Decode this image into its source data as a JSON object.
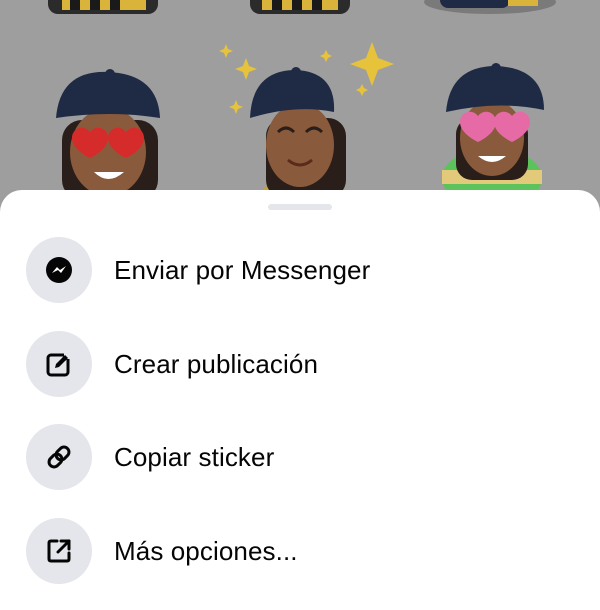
{
  "background": {
    "stickers": [
      "sticker-heart-eyes",
      "sticker-happy-sparkles",
      "sticker-heart-eyes-easter-egg"
    ]
  },
  "sheet": {
    "items": [
      {
        "label": "Enviar por Messenger",
        "icon": "messenger-icon"
      },
      {
        "label": "Crear publicación",
        "icon": "edit-post-icon"
      },
      {
        "label": "Copiar sticker",
        "icon": "link-icon"
      },
      {
        "label": "Más opciones...",
        "icon": "external-share-icon"
      }
    ]
  },
  "colors": {
    "scrim": "#9e9e9e",
    "icon_circle": "#e4e6eb",
    "text": "#050505"
  }
}
